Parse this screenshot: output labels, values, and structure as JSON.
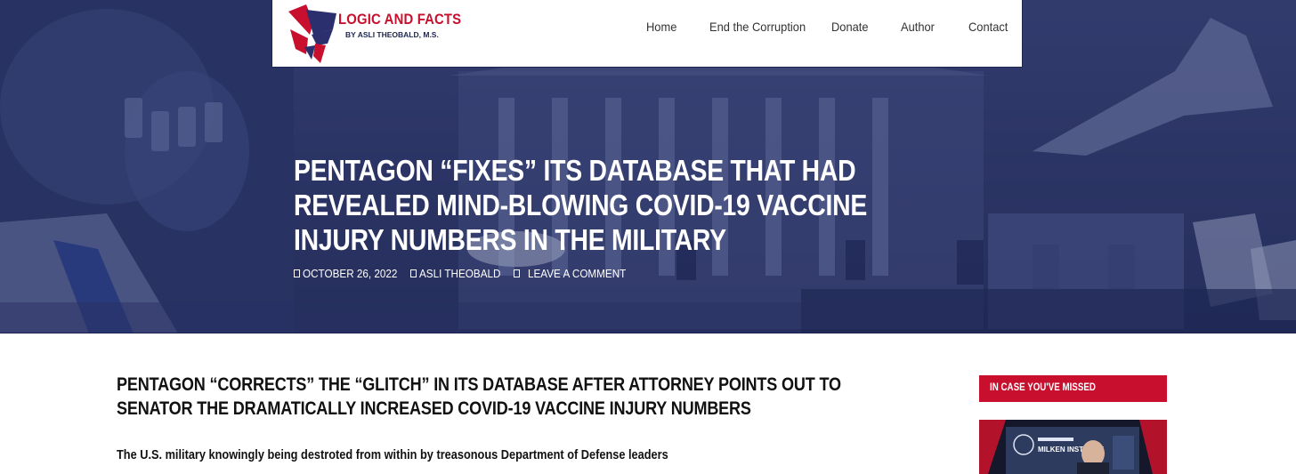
{
  "site": {
    "logo_title": "LOGIC AND FACTS",
    "logo_subtitle": "BY ASLI THEOBALD, M.S."
  },
  "nav": {
    "items": [
      {
        "label": "Home"
      },
      {
        "label": "End the Corruption"
      },
      {
        "label": "Donate"
      },
      {
        "label": "Author"
      },
      {
        "label": "Contact"
      }
    ]
  },
  "hero": {
    "title": "PENTAGON “FIXES” ITS DATABASE THAT HAD REVEALED MIND-BLOWING COVID-19 VACCINE INJURY NUMBERS IN THE MILITARY",
    "meta": {
      "date": "OCTOBER 26, 2022",
      "author": "ASLI THEOBALD",
      "comment": "LEAVE A COMMENT"
    }
  },
  "article": {
    "subtitle": "PENTAGON “CORRECTS” THE “GLITCH” IN ITS DATABASE AFTER ATTORNEY POINTS OUT TO SENATOR THE DRAMATICALLY INCREASED COVID-19 VACCINE INJURY NUMBERS",
    "lead": "The U.S. military knowingly being destroted from within by treasonous Department of Defense leaders"
  },
  "sidebar": {
    "heading": "IN CASE YOU'VE MISSED",
    "thumb_caption": "MILKEN INSTITUTE"
  },
  "colors": {
    "brand_red": "#c8102e",
    "brand_navy": "#1d2550",
    "hero_overlay": "#2a3566"
  }
}
